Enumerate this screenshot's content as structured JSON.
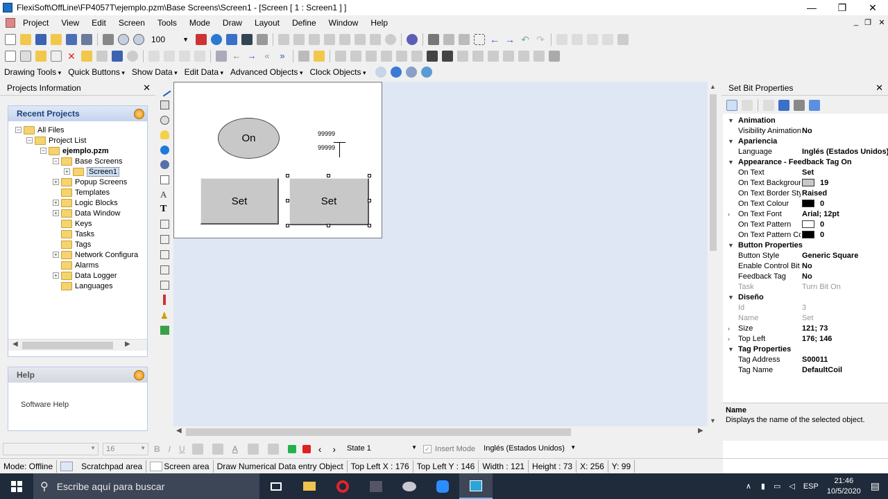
{
  "window": {
    "title": "FlexiSoft\\OffLine\\FP4057T\\ejemplo.pzm\\Base Screens\\Screen1 - [Screen  [ 1 :  Screen1 ] ]",
    "min": "—",
    "max": "❐",
    "close": "✕"
  },
  "menu": [
    "Project",
    "View",
    "Edit",
    "Screen",
    "Tools",
    "Mode",
    "Draw",
    "Layout",
    "Define",
    "Window",
    "Help"
  ],
  "mdi": {
    "min": "_",
    "restore": "❐",
    "close": "✕"
  },
  "zoom": "100",
  "drawbar": [
    "Drawing Tools",
    "Quick Buttons",
    "Show Data",
    "Edit Data",
    "Advanced Objects",
    "Clock Objects"
  ],
  "left_panel": {
    "title": "Projects Information",
    "close": "✕",
    "recent_title": "Recent Projects",
    "tree": {
      "all_files": "All Files",
      "project_list": "Project List",
      "project": "ejemplo.pzm",
      "base_screens": "Base Screens",
      "screen1": "Screen1",
      "items": [
        "Popup Screens",
        "Templates",
        "Logic Blocks",
        "Data Window",
        "Keys",
        "Tasks",
        "Tags",
        "Network Configura",
        "Alarms",
        "Data Logger",
        "Languages"
      ]
    },
    "help_title": "Help",
    "help_link": "Software Help"
  },
  "canvas": {
    "lamp_label": "On",
    "num1": "99999",
    "num2": "99999",
    "btn1": "Set",
    "btn2": "Set"
  },
  "right_panel": {
    "title": "Set Bit Properties",
    "close": "✕",
    "rows": [
      {
        "type": "cat",
        "name": "Animation"
      },
      {
        "name": "Visibility Animation",
        "value": "No"
      },
      {
        "type": "cat",
        "name": "Apariencia"
      },
      {
        "name": "Language",
        "value": "Inglés (Estados Unidos)"
      },
      {
        "type": "cat",
        "name": "Appearance - Feedback Tag On"
      },
      {
        "name": "On Text",
        "value": "Set"
      },
      {
        "name": "On Text Background",
        "value": "19",
        "swatch": "#c8c8c8"
      },
      {
        "name": "On Text Border Style",
        "value": "Raised"
      },
      {
        "name": "On Text Colour",
        "value": "0",
        "swatch": "#000000"
      },
      {
        "name": "On Text Font",
        "value": "Arial; 12pt",
        "expand": true
      },
      {
        "name": "On Text Pattern",
        "value": "0",
        "swatch": "#ffffff"
      },
      {
        "name": "On Text Pattern Colour",
        "value": "0",
        "swatch": "#000000"
      },
      {
        "type": "cat",
        "name": "Button Properties"
      },
      {
        "name": "Button Style",
        "value": "Generic Square"
      },
      {
        "name": "Enable Control Bit",
        "value": "No"
      },
      {
        "name": "Feedback Tag",
        "value": "No"
      },
      {
        "name": "Task",
        "value": "Turn Bit On",
        "disabled": true
      },
      {
        "type": "cat",
        "name": "Diseño"
      },
      {
        "name": "Id",
        "value": "3",
        "disabled": true
      },
      {
        "name": "Name",
        "value": "Set",
        "disabled": true
      },
      {
        "name": "Size",
        "value": "121; 73",
        "expand": true
      },
      {
        "name": "Top Left",
        "value": "176; 146",
        "expand": true
      },
      {
        "type": "cat",
        "name": "Tag Properties"
      },
      {
        "name": "Tag Address",
        "value": "S00011"
      },
      {
        "name": "Tag Name",
        "value": "DefaultCoil"
      }
    ],
    "desc_title": "Name",
    "desc_text": "Displays the name of the selected object."
  },
  "formatbar": {
    "font_size": "16",
    "state": "State 1",
    "insert_mode": "Insert Mode",
    "language": "Inglés (Estados Unidos)"
  },
  "status": [
    "Mode: Offline",
    "Scratchpad area",
    "Screen area",
    "Draw Numerical Data entry Object",
    "Top Left X : 176",
    "Top Left Y : 146",
    "Width : 121",
    "Height : 73",
    "X: 256",
    "Y: 99"
  ],
  "taskbar": {
    "search": "Escribe aquí para buscar",
    "lang": "ESP",
    "time": "21:46",
    "date": "10/5/2020"
  }
}
